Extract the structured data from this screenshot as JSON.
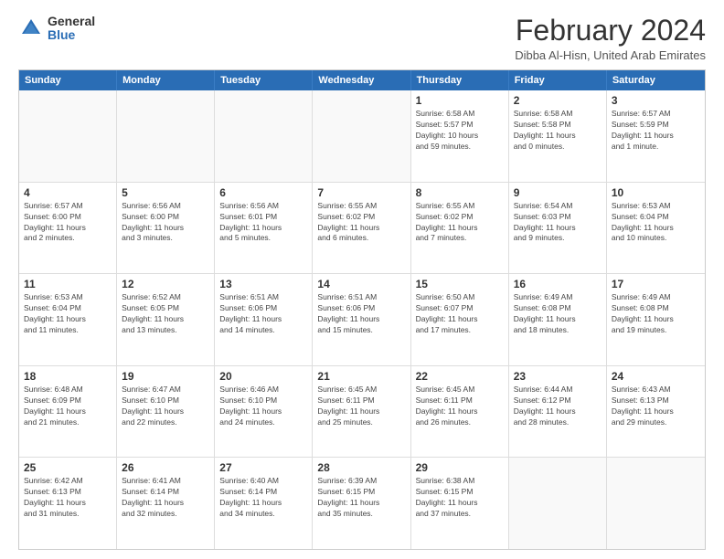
{
  "logo": {
    "general": "General",
    "blue": "Blue"
  },
  "title": "February 2024",
  "location": "Dibba Al-Hisn, United Arab Emirates",
  "header_days": [
    "Sunday",
    "Monday",
    "Tuesday",
    "Wednesday",
    "Thursday",
    "Friday",
    "Saturday"
  ],
  "weeks": [
    [
      {
        "day": "",
        "info": ""
      },
      {
        "day": "",
        "info": ""
      },
      {
        "day": "",
        "info": ""
      },
      {
        "day": "",
        "info": ""
      },
      {
        "day": "1",
        "info": "Sunrise: 6:58 AM\nSunset: 5:57 PM\nDaylight: 10 hours\nand 59 minutes."
      },
      {
        "day": "2",
        "info": "Sunrise: 6:58 AM\nSunset: 5:58 PM\nDaylight: 11 hours\nand 0 minutes."
      },
      {
        "day": "3",
        "info": "Sunrise: 6:57 AM\nSunset: 5:59 PM\nDaylight: 11 hours\nand 1 minute."
      }
    ],
    [
      {
        "day": "4",
        "info": "Sunrise: 6:57 AM\nSunset: 6:00 PM\nDaylight: 11 hours\nand 2 minutes."
      },
      {
        "day": "5",
        "info": "Sunrise: 6:56 AM\nSunset: 6:00 PM\nDaylight: 11 hours\nand 3 minutes."
      },
      {
        "day": "6",
        "info": "Sunrise: 6:56 AM\nSunset: 6:01 PM\nDaylight: 11 hours\nand 5 minutes."
      },
      {
        "day": "7",
        "info": "Sunrise: 6:55 AM\nSunset: 6:02 PM\nDaylight: 11 hours\nand 6 minutes."
      },
      {
        "day": "8",
        "info": "Sunrise: 6:55 AM\nSunset: 6:02 PM\nDaylight: 11 hours\nand 7 minutes."
      },
      {
        "day": "9",
        "info": "Sunrise: 6:54 AM\nSunset: 6:03 PM\nDaylight: 11 hours\nand 9 minutes."
      },
      {
        "day": "10",
        "info": "Sunrise: 6:53 AM\nSunset: 6:04 PM\nDaylight: 11 hours\nand 10 minutes."
      }
    ],
    [
      {
        "day": "11",
        "info": "Sunrise: 6:53 AM\nSunset: 6:04 PM\nDaylight: 11 hours\nand 11 minutes."
      },
      {
        "day": "12",
        "info": "Sunrise: 6:52 AM\nSunset: 6:05 PM\nDaylight: 11 hours\nand 13 minutes."
      },
      {
        "day": "13",
        "info": "Sunrise: 6:51 AM\nSunset: 6:06 PM\nDaylight: 11 hours\nand 14 minutes."
      },
      {
        "day": "14",
        "info": "Sunrise: 6:51 AM\nSunset: 6:06 PM\nDaylight: 11 hours\nand 15 minutes."
      },
      {
        "day": "15",
        "info": "Sunrise: 6:50 AM\nSunset: 6:07 PM\nDaylight: 11 hours\nand 17 minutes."
      },
      {
        "day": "16",
        "info": "Sunrise: 6:49 AM\nSunset: 6:08 PM\nDaylight: 11 hours\nand 18 minutes."
      },
      {
        "day": "17",
        "info": "Sunrise: 6:49 AM\nSunset: 6:08 PM\nDaylight: 11 hours\nand 19 minutes."
      }
    ],
    [
      {
        "day": "18",
        "info": "Sunrise: 6:48 AM\nSunset: 6:09 PM\nDaylight: 11 hours\nand 21 minutes."
      },
      {
        "day": "19",
        "info": "Sunrise: 6:47 AM\nSunset: 6:10 PM\nDaylight: 11 hours\nand 22 minutes."
      },
      {
        "day": "20",
        "info": "Sunrise: 6:46 AM\nSunset: 6:10 PM\nDaylight: 11 hours\nand 24 minutes."
      },
      {
        "day": "21",
        "info": "Sunrise: 6:45 AM\nSunset: 6:11 PM\nDaylight: 11 hours\nand 25 minutes."
      },
      {
        "day": "22",
        "info": "Sunrise: 6:45 AM\nSunset: 6:11 PM\nDaylight: 11 hours\nand 26 minutes."
      },
      {
        "day": "23",
        "info": "Sunrise: 6:44 AM\nSunset: 6:12 PM\nDaylight: 11 hours\nand 28 minutes."
      },
      {
        "day": "24",
        "info": "Sunrise: 6:43 AM\nSunset: 6:13 PM\nDaylight: 11 hours\nand 29 minutes."
      }
    ],
    [
      {
        "day": "25",
        "info": "Sunrise: 6:42 AM\nSunset: 6:13 PM\nDaylight: 11 hours\nand 31 minutes."
      },
      {
        "day": "26",
        "info": "Sunrise: 6:41 AM\nSunset: 6:14 PM\nDaylight: 11 hours\nand 32 minutes."
      },
      {
        "day": "27",
        "info": "Sunrise: 6:40 AM\nSunset: 6:14 PM\nDaylight: 11 hours\nand 34 minutes."
      },
      {
        "day": "28",
        "info": "Sunrise: 6:39 AM\nSunset: 6:15 PM\nDaylight: 11 hours\nand 35 minutes."
      },
      {
        "day": "29",
        "info": "Sunrise: 6:38 AM\nSunset: 6:15 PM\nDaylight: 11 hours\nand 37 minutes."
      },
      {
        "day": "",
        "info": ""
      },
      {
        "day": "",
        "info": ""
      }
    ]
  ]
}
